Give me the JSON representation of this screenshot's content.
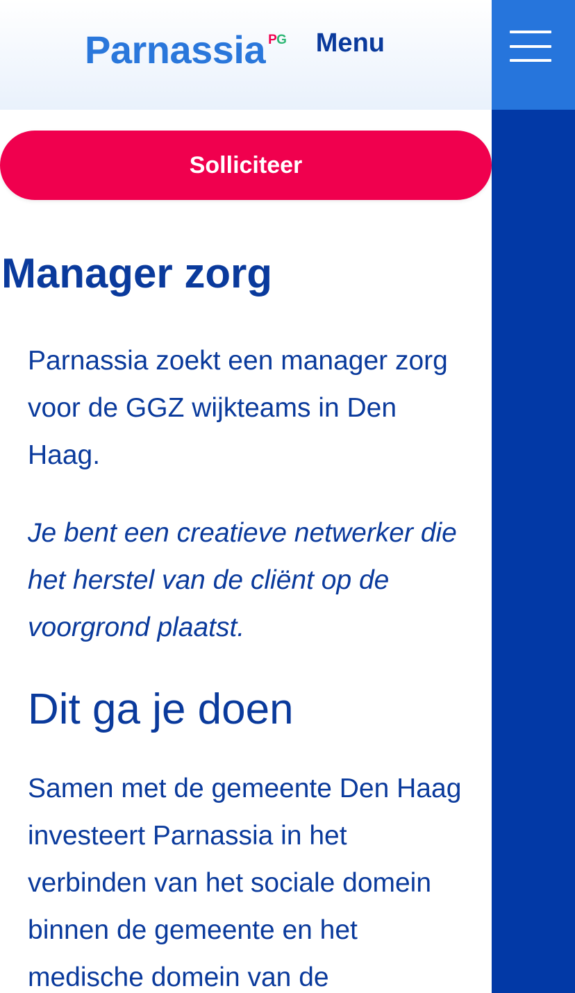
{
  "header": {
    "logo_text": "Parnassia",
    "logo_badge": "PG",
    "logo_badge_colors": [
      "#f0004e",
      "#f7a600",
      "#2675dc",
      "#2bb673"
    ],
    "menu_label": "Menu",
    "menu_icon": "hamburger-icon"
  },
  "cta": {
    "apply_label": "Solliciteer"
  },
  "vacancy": {
    "title": "Manager zorg",
    "intro": "Parnassia zoekt een manager zorg voor de GGZ wijkteams in Den Haag.",
    "tagline": "Je bent een creatieve netwerker die het herstel van de cliënt op de voorgrond plaatst.",
    "section_heading": "Dit ga je doen",
    "section_body": "Samen met de gemeente Den Haag investeert Parnassia in het verbinden van het sociale domein binnen de gemeente en het medische domein van de"
  },
  "colors": {
    "brand_blue": "#0a3a9c",
    "logo_blue": "#2a77db",
    "menu_button_blue": "#2675dc",
    "side_panel_blue": "#0239a6",
    "cta_red": "#f0004e"
  }
}
